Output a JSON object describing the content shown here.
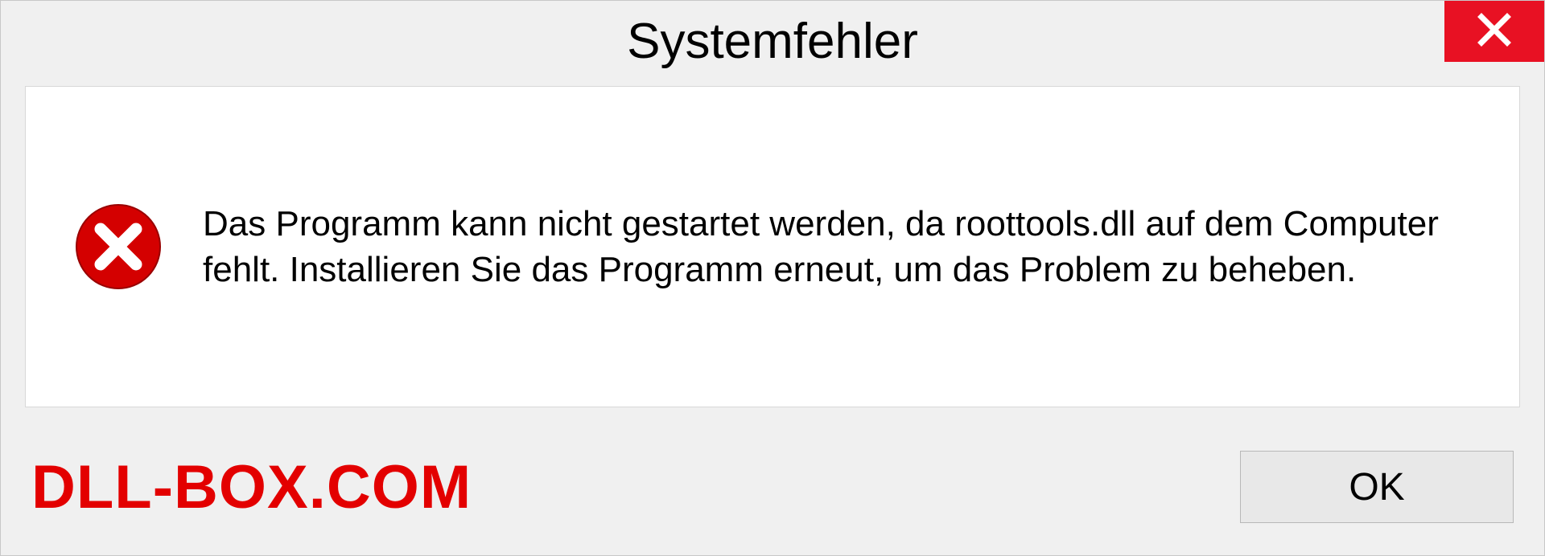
{
  "dialog": {
    "title": "Systemfehler",
    "message": "Das Programm kann nicht gestartet werden, da roottools.dll auf dem Computer fehlt. Installieren Sie das Programm erneut, um das Problem zu beheben.",
    "ok_label": "OK"
  },
  "watermark": "DLL-BOX.COM",
  "colors": {
    "close_button": "#e81123",
    "error_icon": "#d40000",
    "watermark": "#e30000"
  }
}
